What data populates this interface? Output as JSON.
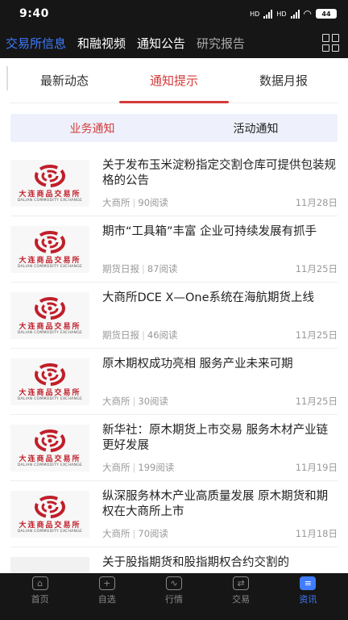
{
  "status_bar": {
    "time": "9:40",
    "net1": "HD",
    "net2": "HD",
    "battery": "44"
  },
  "top_tabs": [
    {
      "label": "交易所信息",
      "active": true
    },
    {
      "label": "和融视频",
      "active": false
    },
    {
      "label": "通知公告",
      "active": false
    },
    {
      "label": "研究报告",
      "active": false
    }
  ],
  "sub_tabs": [
    {
      "label": "最新动态"
    },
    {
      "label": "通知提示"
    },
    {
      "label": "数据月报"
    }
  ],
  "segment": {
    "left": "业务通知",
    "right": "活动通知"
  },
  "logo": {
    "cn": "大连商品交易所",
    "en": "DALIAN COMMODITY EXCHANGE"
  },
  "news": [
    {
      "title": "关于发布玉米淀粉指定交割仓库可提供包装规格的公告",
      "source": "大商所",
      "reads": "90阅读",
      "date": "11月28日"
    },
    {
      "title": "期市“工具箱”丰富 企业可持续发展有抓手",
      "source": "期货日报",
      "reads": "87阅读",
      "date": "11月25日"
    },
    {
      "title": "大商所DCE X—One系统在海航期货上线",
      "source": "期货日报",
      "reads": "46阅读",
      "date": "11月25日"
    },
    {
      "title": "原木期权成功亮相 服务产业未来可期",
      "source": "大商所",
      "reads": "30阅读",
      "date": "11月25日"
    },
    {
      "title": "新华社：原木期货上市交易 服务木材产业链更好发展",
      "source": "大商所",
      "reads": "199阅读",
      "date": "11月19日"
    },
    {
      "title": "纵深服务林木产业高质量发展 原木期货和期权在大商所上市",
      "source": "大商所",
      "reads": "70阅读",
      "date": "11月18日"
    },
    {
      "title": "关于股指期货和股指期权合约交割的"
    }
  ],
  "bottom_nav": [
    {
      "label": "首页",
      "icon": "home-icon",
      "glyph": "⌂"
    },
    {
      "label": "自选",
      "icon": "add-icon",
      "glyph": "+"
    },
    {
      "label": "行情",
      "icon": "chart-icon",
      "glyph": "∿"
    },
    {
      "label": "交易",
      "icon": "exchange-icon",
      "glyph": "⇄"
    },
    {
      "label": "资讯",
      "icon": "news-icon",
      "glyph": "≡"
    }
  ],
  "colors": {
    "accent_red": "#d43a3a",
    "accent_blue": "#3f7cff",
    "dark_bar": "#161616",
    "logo_red": "#c01f2a"
  }
}
